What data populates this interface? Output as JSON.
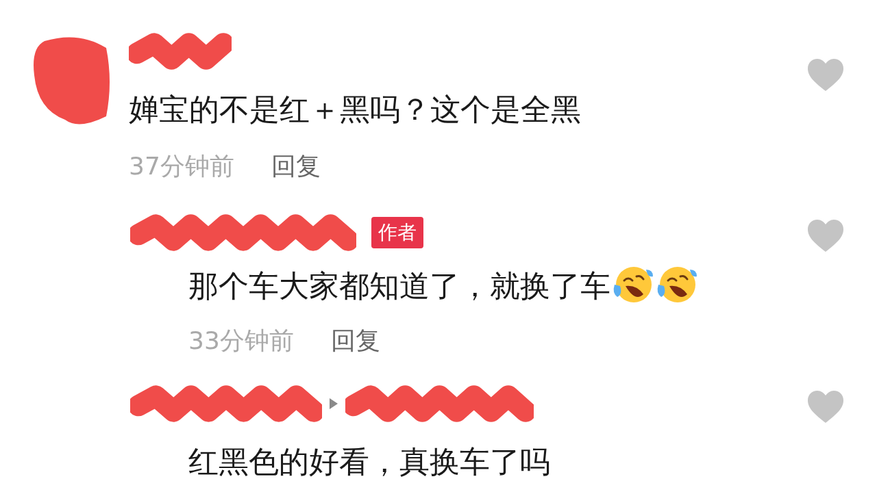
{
  "comments": [
    {
      "avatar_redacted": true,
      "name_redacted": true,
      "text": "婵宝的不是红＋黑吗？这个是全黑",
      "time": "37分钟前",
      "reply_label": "回复",
      "liked": false,
      "replies": [
        {
          "name_redacted": true,
          "reply_target_redacted": false,
          "badge": "作者",
          "text": "那个车大家都知道了，就换了车",
          "emojis": [
            {
              "kind": "tears_of_joy"
            },
            {
              "kind": "tears_of_joy"
            }
          ],
          "time": "33分钟前",
          "reply_label": "回复",
          "liked": false
        },
        {
          "name_redacted": true,
          "reply_target_redacted": true,
          "text": "红黑色的好看，真换车了吗",
          "liked": false
        }
      ]
    }
  ]
}
